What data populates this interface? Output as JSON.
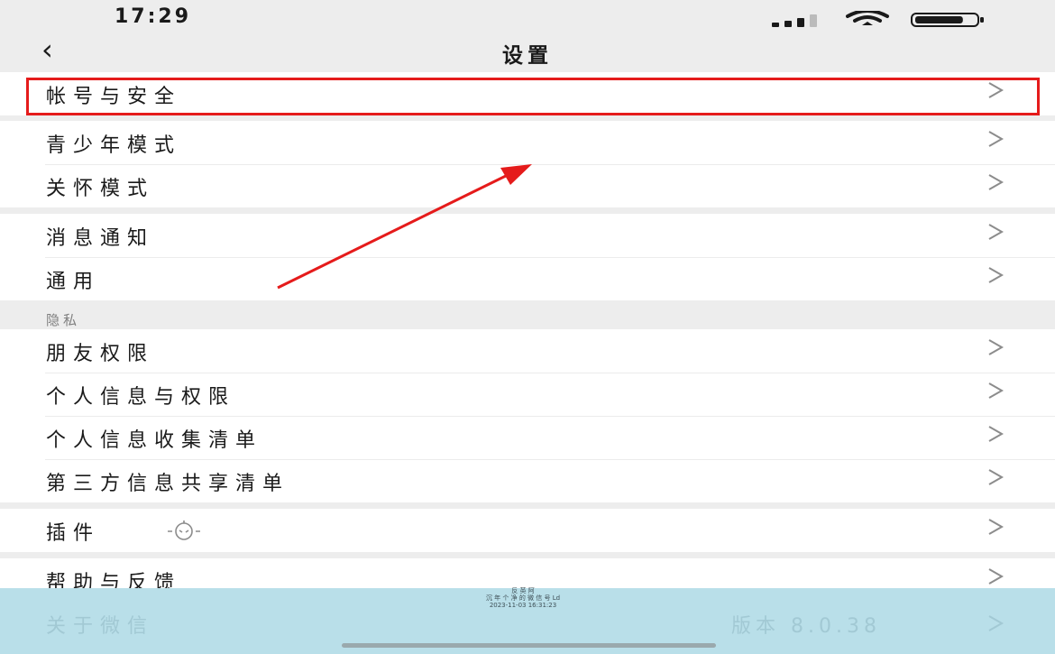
{
  "status_bar": {
    "time": "17:29",
    "battery_level": 0.8
  },
  "nav": {
    "back_icon": "‹",
    "title": "设置"
  },
  "groups": [
    {
      "items": [
        {
          "label": "帐号与安全"
        }
      ]
    },
    {
      "items": [
        {
          "label": "青少年模式"
        },
        {
          "label": "关怀模式"
        }
      ]
    },
    {
      "items": [
        {
          "label": "消息通知"
        },
        {
          "label": "通用"
        }
      ]
    },
    {
      "section_label": "隐私",
      "items": [
        {
          "label": "朋友权限"
        },
        {
          "label": "个人信息与权限"
        },
        {
          "label": "个人信息收集清单"
        },
        {
          "label": "第三方信息共享清单"
        }
      ]
    },
    {
      "items": [
        {
          "label": "插件",
          "icon": "plugin-icon"
        }
      ]
    },
    {
      "items": [
        {
          "label": "帮助与反馈"
        }
      ]
    }
  ],
  "about": {
    "label": "关于微信",
    "version": "版本 8.0.38"
  },
  "watermark": {
    "line1": "反 英 阿",
    "line2": "沉 年 个 净 的 微 信 号 Ld",
    "line3": "2023-11-03 16:31:23"
  },
  "annotation": {
    "highlight_color": "#e51b1b",
    "arrow_color": "#e51b1b"
  }
}
